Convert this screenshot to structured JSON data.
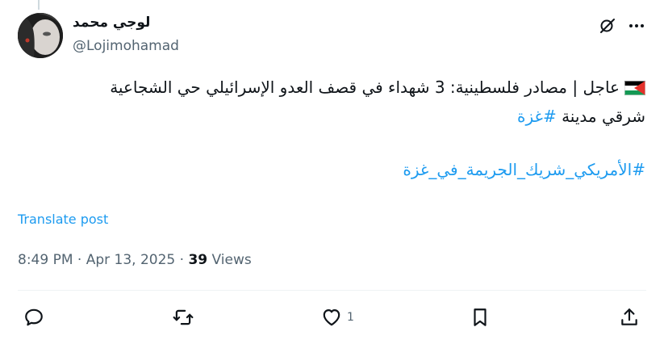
{
  "author": {
    "display_name": "لوجي محمد",
    "username": "@Lojimohamad"
  },
  "tweet": {
    "flag_icon": "palestine-flag",
    "line1": "عاجل | مصادر فلسطينية: 3 شهداء في قصف العدو الإسرائيلي  حي الشجاعية",
    "line2_text": "شرقي مدينة ",
    "line2_hashtag": "#غزة",
    "hashtag_line": "#الأمريكي_شريك_الجريمة_في_غزة"
  },
  "translate_label": "Translate post",
  "meta": {
    "time": "8:49 PM",
    "sep1": " · ",
    "date": "Apr 13, 2025",
    "sep2": " · ",
    "views_count": "39",
    "views_label": " Views"
  },
  "actions": {
    "reply_count": "",
    "retweet_count": "",
    "like_count": "1"
  },
  "colors": {
    "link": "#1d9bf0",
    "secondary_text": "#536471",
    "primary_text": "#0f1419"
  }
}
